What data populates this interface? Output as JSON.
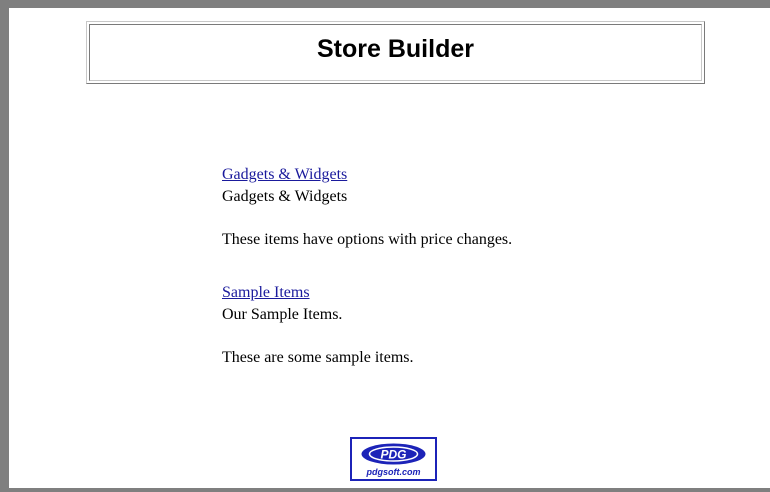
{
  "header": {
    "title": "Store Builder"
  },
  "categories": [
    {
      "link_label": "Gadgets & Widgets",
      "name": "Gadgets & Widgets",
      "description": "These items have options with price changes."
    },
    {
      "link_label": "Sample Items",
      "name": "Our Sample Items.",
      "description": "These are some sample items."
    }
  ],
  "footer": {
    "logo_mark": "PDG",
    "logo_caption": "pdgsoft.com",
    "logo_color": "#1c23b8"
  }
}
